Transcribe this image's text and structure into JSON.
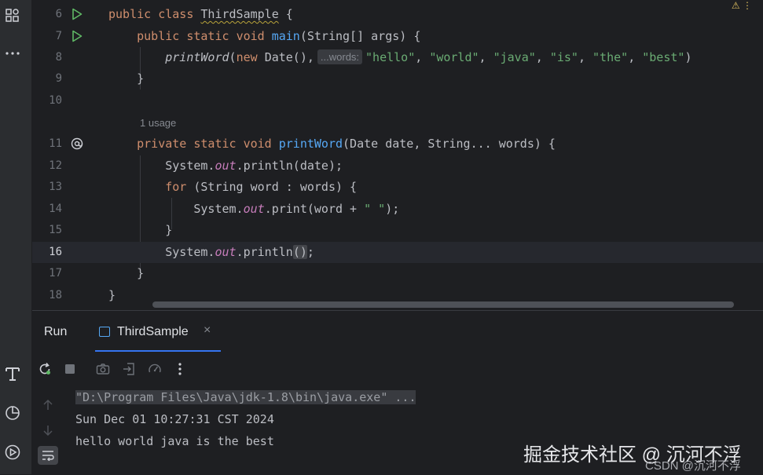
{
  "editor": {
    "lines": [
      {
        "num": "6"
      },
      {
        "num": "7"
      },
      {
        "num": "8",
        "hint": "...words:"
      },
      {
        "num": "9"
      },
      {
        "num": "10"
      },
      {
        "usage": "1 usage"
      },
      {
        "num": "11"
      },
      {
        "num": "12"
      },
      {
        "num": "13"
      },
      {
        "num": "14"
      },
      {
        "num": "15"
      },
      {
        "num": "16"
      },
      {
        "num": "17"
      },
      {
        "num": "18"
      }
    ],
    "tokens": {
      "l6": [
        "public",
        "class",
        "ThirdSample",
        "{"
      ],
      "l7": [
        "public",
        "static",
        "void",
        "main",
        "(String[] args) {"
      ],
      "l8": [
        "printWord",
        "(",
        "new",
        "Date(),",
        "\"hello\"",
        ",",
        "\"world\"",
        ",",
        "\"java\"",
        ",",
        "\"is\"",
        ",",
        "\"the\"",
        ",",
        "\"best\"",
        ")"
      ],
      "l9": [
        "}"
      ],
      "l11": [
        "private",
        "static",
        "void",
        "printWord",
        "(Date date, String... words) {"
      ],
      "l12": [
        "System.",
        "out",
        ".println(date);"
      ],
      "l13": [
        "for",
        "(String word : words) {"
      ],
      "l14": [
        "System.",
        "out",
        ".print(word + ",
        "\" \"",
        ");"
      ],
      "l15": [
        "}"
      ],
      "l16": [
        "System.",
        "out",
        ".println",
        "()",
        ";"
      ],
      "l17": [
        "}"
      ],
      "l18": [
        "}"
      ]
    }
  },
  "run": {
    "title": "Run",
    "tab_label": "ThirdSample",
    "close": "×"
  },
  "console": {
    "lines": [
      "\"D:\\Program Files\\Java\\jdk-1.8\\bin\\java.exe\" ...",
      "Sun Dec 01 10:27:31 CST 2024",
      "hello world java is the best"
    ]
  },
  "watermark": {
    "main": "掘金技术社区 @ 沉河不浮",
    "sub": "CSDN @沉河不浮"
  },
  "colors": {
    "keyword": "#cf8e6d",
    "function": "#56a8f5",
    "string": "#6aab73",
    "field": "#c77dbb",
    "accent": "#3574f0"
  }
}
